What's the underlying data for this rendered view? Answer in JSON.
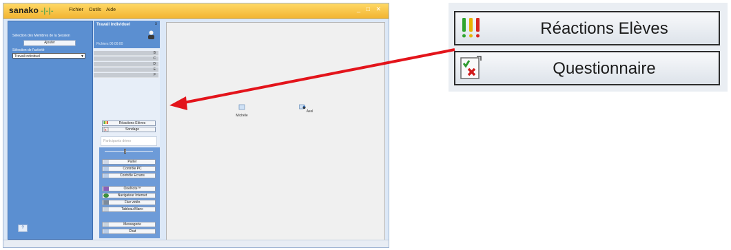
{
  "app": {
    "logo": "sanako",
    "menu": [
      "Fichier",
      "Outils",
      "Aide"
    ],
    "window_controls": "_ □ ✕"
  },
  "session_panel": {
    "members_label": "Sélection des Membres de la Session",
    "add_button": "Ajouter",
    "activity_label": "Sélection de l'activité",
    "activity_value": "Travail individuel"
  },
  "activity_panel": {
    "title": "Travail individuel",
    "subtitle": "Fichiers  00:00:00",
    "close": "x",
    "rows": [
      "B",
      "C",
      "D",
      "E",
      "F"
    ],
    "buttons": [
      {
        "label": "Réactions Elèves",
        "icon": "traffic-lights-icon"
      },
      {
        "label": "Sondage",
        "icon": "questionnaire-icon"
      }
    ],
    "participants_placeholder": "Participants démo",
    "control_buttons": [
      {
        "label": "Parler",
        "icon": "speaker-icon"
      },
      {
        "label": "Contrôle PC",
        "icon": "monitor-icon"
      },
      {
        "label": "Contrôle Ecrans",
        "icon": "screens-icon"
      }
    ],
    "tool_buttons": [
      {
        "label": "OneNote™",
        "icon": "onenote-icon"
      },
      {
        "label": "Navigateur Internet",
        "icon": "browser-icon"
      },
      {
        "label": "Flux vidéo",
        "icon": "video-icon"
      },
      {
        "label": "Tableau Blanc",
        "icon": "whiteboard-icon"
      }
    ],
    "comm_buttons": [
      {
        "label": "Messagerie",
        "icon": "message-icon"
      },
      {
        "label": "Chat",
        "icon": "chat-icon"
      }
    ]
  },
  "workspace": {
    "students": [
      {
        "name": "Michèle",
        "icon": "student-pc-icon"
      },
      {
        "name": "Axel",
        "icon": "teacher-pc-icon"
      }
    ]
  },
  "callout": {
    "buttons": [
      {
        "label": "Réactions Elèves",
        "icon": "traffic-lights-icon"
      },
      {
        "label": "Questionnaire",
        "icon": "questionnaire-icon"
      }
    ]
  },
  "colors": {
    "titlebar": "#f2b533",
    "panel_blue": "#5b8fd1",
    "arrow_red": "#e3141b"
  }
}
